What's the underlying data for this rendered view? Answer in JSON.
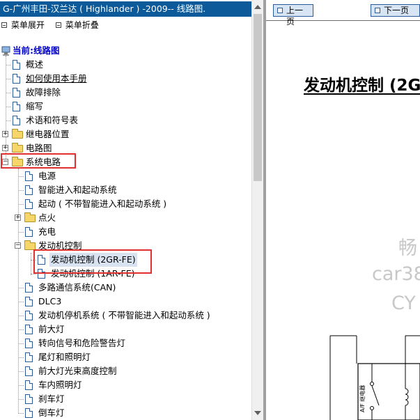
{
  "window_title": "G-广州丰田-汉兰达 ( Highlander ) -2009-- 线路图.",
  "menu": {
    "expand_label": "菜单展开",
    "collapse_label": "菜单折叠"
  },
  "tree": {
    "root_label": "当前:线路图",
    "items": [
      {
        "label": "概述",
        "type": "doc"
      },
      {
        "label": "如何使用本手册",
        "type": "doc"
      },
      {
        "label": "故障排除",
        "type": "doc"
      },
      {
        "label": "缩写",
        "type": "doc"
      },
      {
        "label": "术语和符号表",
        "type": "doc"
      },
      {
        "label": "继电器位置",
        "type": "folder",
        "state": "collapsed"
      },
      {
        "label": "电路图",
        "type": "folder",
        "state": "collapsed"
      },
      {
        "label": "系统电路",
        "type": "folder",
        "state": "expanded"
      }
    ],
    "system_children": [
      {
        "label": "电源",
        "type": "doc"
      },
      {
        "label": "智能进入和起动系统",
        "type": "doc"
      },
      {
        "label": "起动 ( 不带智能进入和起动系统 )",
        "type": "doc"
      },
      {
        "label": "点火",
        "type": "folder",
        "state": "collapsed"
      },
      {
        "label": "充电",
        "type": "doc"
      },
      {
        "label": "发动机控制",
        "type": "folder",
        "state": "expanded"
      },
      {
        "label": "发动机控制 (2GR-FE)",
        "type": "doc",
        "selected": true
      },
      {
        "label": "发动机控制 (1AR-FE)",
        "type": "doc"
      },
      {
        "label": "多路通信系统(CAN)",
        "type": "doc"
      },
      {
        "label": "DLC3",
        "type": "doc"
      },
      {
        "label": "发动机停机系统 ( 不带智能进入和起动系统 )",
        "type": "doc"
      },
      {
        "label": "前大灯",
        "type": "doc"
      },
      {
        "label": "转向信号和危险警告灯",
        "type": "doc"
      },
      {
        "label": "尾灯和照明灯",
        "type": "doc"
      },
      {
        "label": "前大灯光束高度控制",
        "type": "doc"
      },
      {
        "label": "车内照明灯",
        "type": "doc"
      },
      {
        "label": "刹车灯",
        "type": "doc"
      },
      {
        "label": "倒车灯",
        "type": "doc"
      }
    ]
  },
  "nav": {
    "prev_label": "上一页",
    "next_label": "下一页"
  },
  "page": {
    "heading": "发动机控制 (2G",
    "watermark_lines": [
      "畅",
      "car38",
      "CY"
    ],
    "diagram_label": "A/F 继电器"
  },
  "colors": {
    "title_bar": "#0c5a9a",
    "highlight_box": "#e03030",
    "selection": "#d8e2f0"
  },
  "icons": {
    "root": "computer-icon",
    "doc": "document-icon",
    "folder": "folder-icon",
    "expander": "plus-minus-icon"
  }
}
